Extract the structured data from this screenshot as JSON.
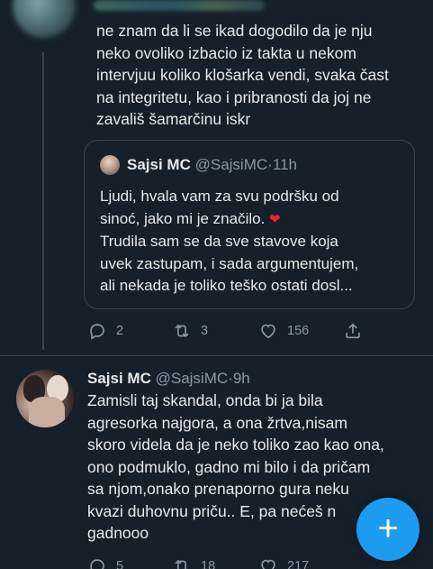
{
  "colors": {
    "background": "#15202b",
    "accent": "#1d9bf0",
    "heart": "#f4212e",
    "muted": "#8b98a5"
  },
  "tweet1": {
    "text": "ne znam da li se ikad dogodilo da je nju\nneko ovoliko izbacio iz takta u nekom\nintervjuu koliko klošarka vendi, svaka čast\nna integritetu, kao i pribranosti da joj ne\nzavališ šamarčinu iskr",
    "quote": {
      "name": "Sajsi MC",
      "handle": "@SajsiMC",
      "time": "11h",
      "text_a": "Ljudi, hvala vam za svu podršku od\nsinoć, jako mi je značilo.",
      "heart_icon": "red-heart-emoji",
      "text_b": "\nTrudila sam se da sve stavove koja\nuvek zastupam, i sada argumentujem,\nali nekada je toliko teško ostati dosl..."
    },
    "actions": {
      "replies": "2",
      "retweets": "3",
      "likes": "156"
    }
  },
  "tweet2": {
    "name": "Sajsi MC",
    "handle": "@SajsiMC",
    "time": "9h",
    "text": "Zamisli taj skandal, onda bi ja bila\nagresorka najgora, a ona žrtva,nisam\nskoro videla da je neko toliko zao kao ona,\nono podmuklo, gadno mi bilo i da pričam\nsa njom,onako prenaporno gura neku\nkvazi duhovnu priču.. E, pa nećeš n\ngadnooo",
    "actions": {
      "replies": "5",
      "retweets": "18",
      "likes": "217"
    }
  },
  "fab": {
    "label": "+"
  },
  "separator": "·"
}
